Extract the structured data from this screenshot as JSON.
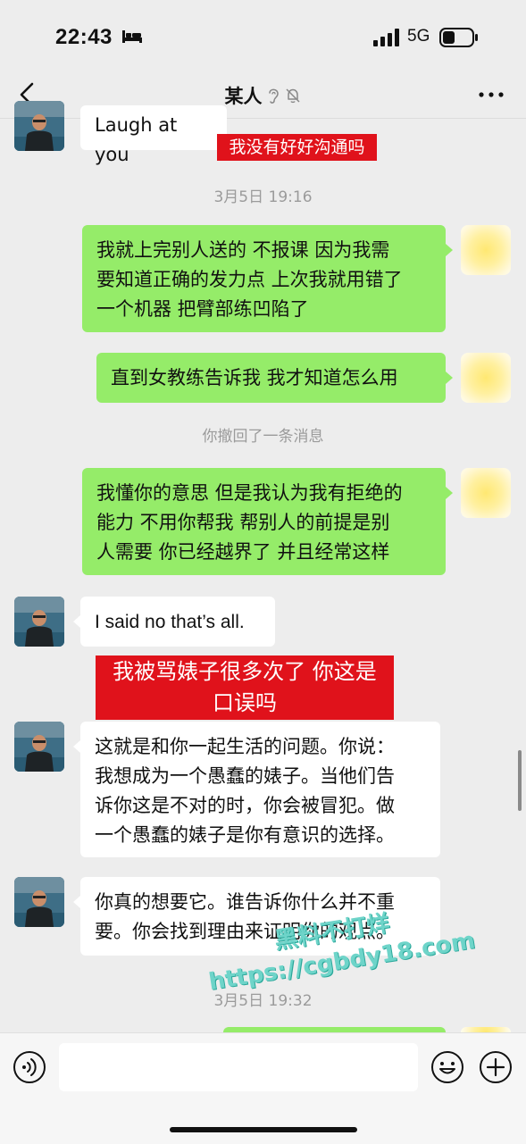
{
  "status_bar": {
    "time": "22:43",
    "network": "5G"
  },
  "header": {
    "title": "某人"
  },
  "messages": {
    "m0": {
      "text": "Laugh at you"
    },
    "n0": {
      "text": "我没有好好沟通吗"
    },
    "t1": {
      "text": "3月5日 19:16"
    },
    "m1": {
      "line1": "我就上完别人送的 不报课 因为我需",
      "line2": "要知道正确的发力点 上次我就用错了",
      "line3": "一个机器 把臂部练凹陷了"
    },
    "m2": {
      "text": "直到女教练告诉我 我才知道怎么用"
    },
    "recall": {
      "text": "你撤回了一条消息"
    },
    "m3": {
      "line1": "我懂你的意思 但是我认为我有拒绝的",
      "line2": "能力 不用你帮我 帮别人的前提是别",
      "line3": "人需要 你已经越界了 并且经常这样"
    },
    "m4": {
      "text": "I said no that’s all."
    },
    "n1": {
      "line1": "我被骂婊子很多次了 你这是",
      "line2": "口误吗"
    },
    "m5": {
      "line1": "这就是和你一起生活的问题。你说：",
      "line2": "我想成为一个愚蠢的婊子。当他们告",
      "line3": "诉你这是不对的时，你会被冒犯。做",
      "line4": "一个愚蠢的婊子是你有意识的选择。"
    },
    "m6": {
      "line1": "你真的想要它。谁告诉你什么并不重",
      "line2": "要。你会找到理由来证明你的观点。"
    },
    "t2": {
      "text": "3月5日 19:32"
    }
  },
  "watermark": {
    "line1": "黑料不打烊",
    "line2": "https://cgbdy18.com"
  },
  "input": {
    "value": ""
  },
  "icons": [
    "bed-icon",
    "signal-icon",
    "battery-icon",
    "back-icon",
    "ear-icon",
    "mute-bell-icon",
    "more-icon",
    "voice-icon",
    "emoji-icon",
    "plus-icon"
  ],
  "colors": {
    "outgoing_bubble": "#95ec69",
    "incoming_bubble": "#ffffff",
    "annotation_red": "#e0121b",
    "background": "#ededed"
  }
}
